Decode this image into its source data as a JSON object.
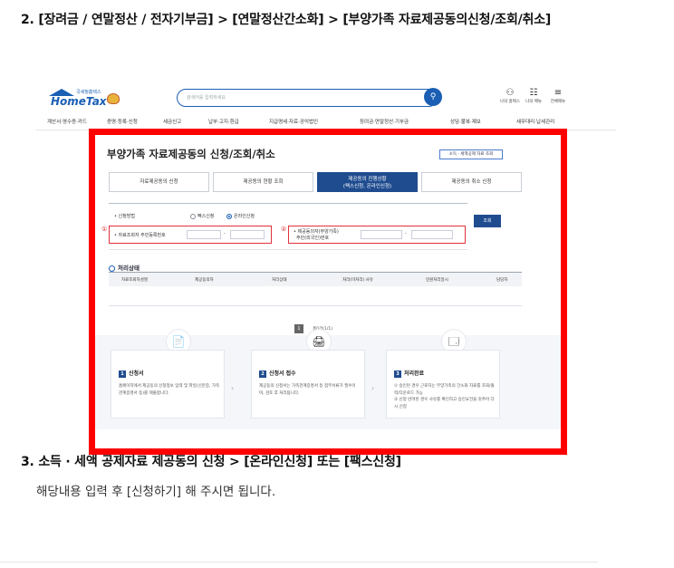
{
  "heading_step2": "2. [장려금 / 연말정산 / 전자기부금] > [연말정산간소화] > [부양가족 자료제공동의신청/조회/취소]",
  "heading_step3": "3. 소득 · 세액 공제자료 제공동의 신청 > [온라인신청] 또는 [팩스신청]",
  "step3_text": "해당내용 입력 후 [신청하기] 해 주시면 됩니다.",
  "screenshot": {
    "logo": {
      "subtitle": "국세청홈택스",
      "name": "HomeTax"
    },
    "search_placeholder": "검색어를 입력하세요",
    "utility": [
      {
        "icon": "user-icon",
        "label": "나의 홈택스"
      },
      {
        "icon": "menu-list-icon",
        "label": "나의 메뉴"
      },
      {
        "icon": "hamburger-icon",
        "label": "전체메뉴"
      }
    ],
    "nav": [
      "계산서·영수증·카드",
      "증명·등록·신청",
      "세금신고",
      "납부·고지·환급",
      "지급명세·자료·공익법인",
      "장려금·연말정산·기부금",
      "상담·불복·제보",
      "세무대리·납세관리"
    ],
    "panel_title": "부양가족 자료제공동의 신청/조회/취소",
    "panel_tag": "소득 · 세액공제 자료 조회",
    "tabs": [
      {
        "label": "자료제공동의 신청",
        "sub": ""
      },
      {
        "label": "제공동의 현황 조회",
        "sub": ""
      },
      {
        "label": "제공동의 진행상황",
        "sub": "(팩스신청, 온라인신청)"
      },
      {
        "label": "제공동의 취소 신청",
        "sub": ""
      }
    ],
    "form": {
      "apply_method_label": "• 신청방법",
      "radio_fax": "팩스신청",
      "radio_online": "온라인신청",
      "marker1": "①",
      "marker2": "②",
      "field1_label": "• 자료조회자 주민등록번호",
      "field2_label_line1": "• 제공동의자(부양가족)",
      "field2_label_line2": "주민(외국인)번호",
      "dash": "-",
      "search_button": "조회"
    },
    "status_section": {
      "title": "처리상태",
      "columns": [
        "자료조회자성명",
        "제공동의자",
        "처리상태",
        "처리(미처리) 사유",
        "민원처리일시",
        "담당자"
      ]
    },
    "pager": {
      "page": "1",
      "info": "총0건(1/1)"
    },
    "steps": [
      {
        "num": "1",
        "icon": "document-icon",
        "title": "신청서",
        "desc": "홈페이지에서 제공동의 신청정보 입력 및 파일(신분증, 가족관계증명서 등)를 제출합니다."
      },
      {
        "num": "2",
        "icon": "printer-icon",
        "title": "신청서 접수",
        "desc": "제공동의 신청서는 가족관계증명서 등 첨부서류가 필수이며, 검토 후 처리됩니다."
      },
      {
        "num": "3",
        "icon": "browser-check-icon",
        "title": "처리완료",
        "desc": "① 승인된 경우 근로자는 부양가족의 간소화 자료를 조회/출력/다운로드 가능\n② 신청 반려된 경우 사유를 확인하고 승인요건을 갖추어 다시 신청"
      }
    ]
  }
}
